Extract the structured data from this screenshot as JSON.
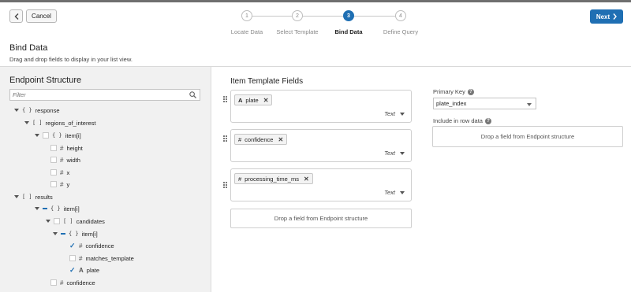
{
  "header": {
    "cancel_label": "Cancel",
    "next_label": "Next",
    "steps": [
      {
        "number": "1",
        "label": "Locate Data"
      },
      {
        "number": "2",
        "label": "Select Template"
      },
      {
        "number": "3",
        "label": "Bind Data"
      },
      {
        "number": "4",
        "label": "Define Query"
      }
    ],
    "active_step": 3
  },
  "page": {
    "title": "Bind Data",
    "subtitle": "Drag and drop fields to display in your list view."
  },
  "endpoint": {
    "title": "Endpoint Structure",
    "filter_placeholder": "Filter",
    "tree": [
      {
        "label": "response",
        "icon": "{}",
        "expander": "expanded",
        "checkbox": "none"
      },
      {
        "label": "regions_of_interest",
        "icon": "[]",
        "expander": "expanded",
        "checkbox": "none"
      },
      {
        "label": "item[i]",
        "icon": "{}",
        "expander": "expanded",
        "checkbox": "unchecked"
      },
      {
        "label": "height",
        "icon": "#",
        "expander": "none",
        "checkbox": "unchecked"
      },
      {
        "label": "width",
        "icon": "#",
        "expander": "none",
        "checkbox": "unchecked"
      },
      {
        "label": "x",
        "icon": "#",
        "expander": "none",
        "checkbox": "unchecked"
      },
      {
        "label": "y",
        "icon": "#",
        "expander": "none",
        "checkbox": "unchecked"
      },
      {
        "label": "results",
        "icon": "[]",
        "expander": "expanded",
        "checkbox": "none"
      },
      {
        "label": "item[i]",
        "icon": "{}",
        "expander": "expanded",
        "checkbox": "partial"
      },
      {
        "label": "candidates",
        "icon": "[]",
        "expander": "expanded",
        "checkbox": "unchecked"
      },
      {
        "label": "item[i]",
        "icon": "{}",
        "expander": "expanded",
        "checkbox": "partial"
      },
      {
        "label": "confidence",
        "icon": "#",
        "expander": "none",
        "checkbox": "checked"
      },
      {
        "label": "matches_template",
        "icon": "#",
        "expander": "none",
        "checkbox": "unchecked"
      },
      {
        "label": "plate",
        "icon": "A",
        "expander": "none",
        "checkbox": "checked"
      },
      {
        "label": "confidence",
        "icon": "#",
        "expander": "none",
        "checkbox": "unchecked"
      }
    ]
  },
  "template": {
    "title": "Item Template Fields",
    "fields": [
      {
        "name": "plate",
        "icon": "A",
        "type": "Text"
      },
      {
        "name": "confidence",
        "icon": "#",
        "type": "Text"
      },
      {
        "name": "processing_time_ms",
        "icon": "#",
        "type": "Text"
      }
    ],
    "drop_hint": "Drop a field from Endpoint structure"
  },
  "settings": {
    "primary_key_label": "Primary Key",
    "primary_key_value": "plate_index",
    "row_data_label": "Include in row data",
    "row_data_drop_hint": "Drop a field from Endpoint structure"
  },
  "colors": {
    "accent": "#1f6fb3",
    "panel_bg": "#f1f1f1"
  }
}
